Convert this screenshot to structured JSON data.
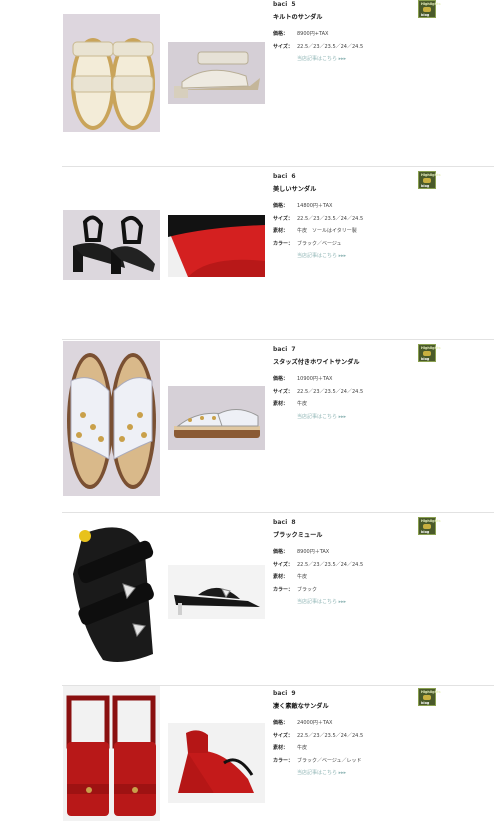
{
  "labels": {
    "price": "価格：",
    "size": "サイズ：",
    "material": "素材：",
    "color": "カラー：",
    "more_link": "当店記事はこちら ▸▸▸",
    "badge_top": "Highlights",
    "badge_bottom": "blog"
  },
  "products": [
    {
      "brand": "baci",
      "number": "5",
      "title": "キルトのサンダル",
      "price": "8900円+TAX",
      "sizes": "22.5／23／23.5／24／24.5",
      "material": "",
      "color": ""
    },
    {
      "brand": "baci",
      "number": "6",
      "title": "美しいサンダル",
      "price": "14800円＋TAX",
      "sizes": "22.5／23／23.5／24／24.5",
      "material": "牛皮　ソールはイタリー製",
      "color": "ブラック／ベージュ"
    },
    {
      "brand": "baci",
      "number": "7",
      "title": "スタッズ付きホワイトサンダル",
      "price": "10900円＋TAX",
      "sizes": "22.5／23／23.5／24／24.5",
      "material": "牛皮",
      "color": ""
    },
    {
      "brand": "baci",
      "number": "8",
      "title": "ブラックミュール",
      "price": "8900円＋TAX",
      "sizes": "22.5／23／23.5／24／24.5",
      "material": "牛皮",
      "color": "ブラック"
    },
    {
      "brand": "baci",
      "number": "9",
      "title": "凄く素敵なサンダル",
      "price": "24000円＋TAX",
      "sizes": "22.5／23／23.5／24／24.5",
      "material": "牛皮",
      "color": "ブラック／ベージュ／レッド"
    }
  ],
  "colors": {
    "photo_bg": "#d8d3d9",
    "link": "#8fb5b5",
    "divider": "#e2e2e2"
  }
}
